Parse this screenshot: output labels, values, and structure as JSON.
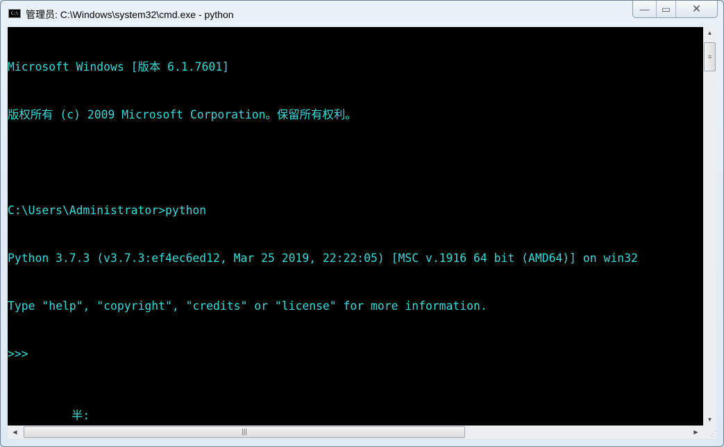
{
  "window": {
    "title": "管理员: C:\\Windows\\system32\\cmd.exe - python",
    "icon": "cmd-icon",
    "icon_text": "C:\\"
  },
  "controls": {
    "minimize": "—",
    "maximize": "▭",
    "close": "✕"
  },
  "console": {
    "text_color": "#3ed8d8",
    "background": "#000000",
    "lines": [
      "Microsoft Windows [版本 6.1.7601]",
      "版权所有 (c) 2009 Microsoft Corporation。保留所有权利。",
      "",
      "C:\\Users\\Administrator>python",
      "Python 3.7.3 (v3.7.3:ef4ec6ed12, Mar 25 2019, 22:22:05) [MSC v.1916 64 bit (AMD64)] on win32",
      "Type \"help\", \"copyright\", \"credits\" or \"license\" for more information.",
      ">>>"
    ],
    "ime_status": "半:"
  },
  "scroll": {
    "up": "▲",
    "down": "▼",
    "left": "◀",
    "right": "▶",
    "thumb_grip_v": "≡",
    "thumb_grip_h": "|||",
    "resize_grip": "⋰"
  }
}
